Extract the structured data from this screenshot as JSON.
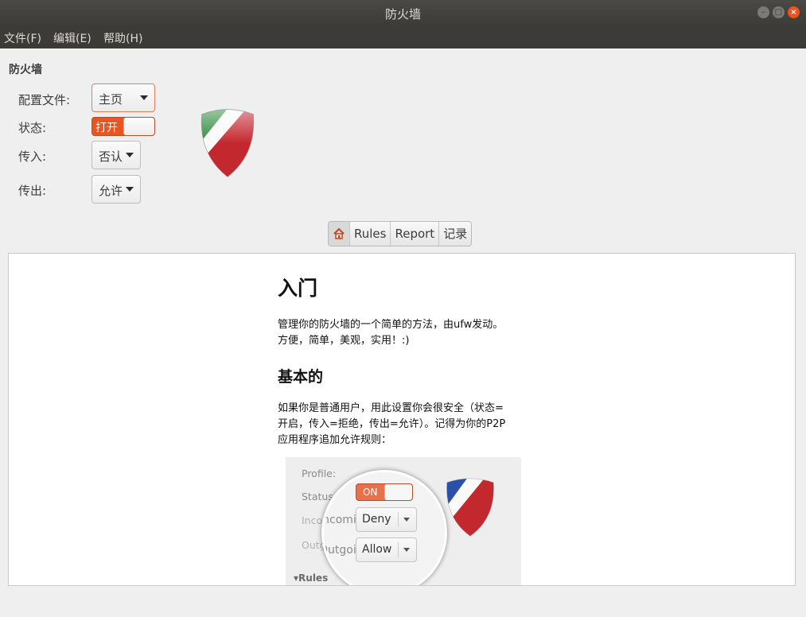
{
  "window": {
    "title": "防火墙"
  },
  "menubar": {
    "items": [
      "文件(F)",
      "编辑(E)",
      "帮助(H)"
    ]
  },
  "panel": {
    "section_title": "防火墙",
    "profile_label": "配置文件:",
    "profile_value": "主页",
    "status_label": "状态:",
    "status_value": "打开",
    "incoming_label": "传入:",
    "incoming_value": "否认",
    "outgoing_label": "传出:",
    "outgoing_value": "允许"
  },
  "tabs": {
    "home_icon": "home-icon",
    "rules": "Rules",
    "report": "Report",
    "log": "记录"
  },
  "content": {
    "h1": "入门",
    "p1_lines": [
      "管理你的防火墙的一个简单的方法，由ufw发动。",
      "方便，简单，美观，实用！:)"
    ],
    "h2": "基本的",
    "p2_lines": [
      "如果你是普通用户，用此设置你会很安全（状态=",
      "开启，传入=拒绝，传出=允许）。记得为你的P2P",
      "应用程序追加允许规则："
    ],
    "screenshot": {
      "profile": "Profile:",
      "status": "Status:",
      "incoming": "Incoming:",
      "outgoing": "Outgoing:",
      "switch_on": "ON",
      "incoming_value": "Deny",
      "outgoing_value": "Allow",
      "rules": "Rules"
    }
  },
  "colors": {
    "accent": "#e95420",
    "titlebar": "#3c3b37",
    "background": "#efefef"
  }
}
